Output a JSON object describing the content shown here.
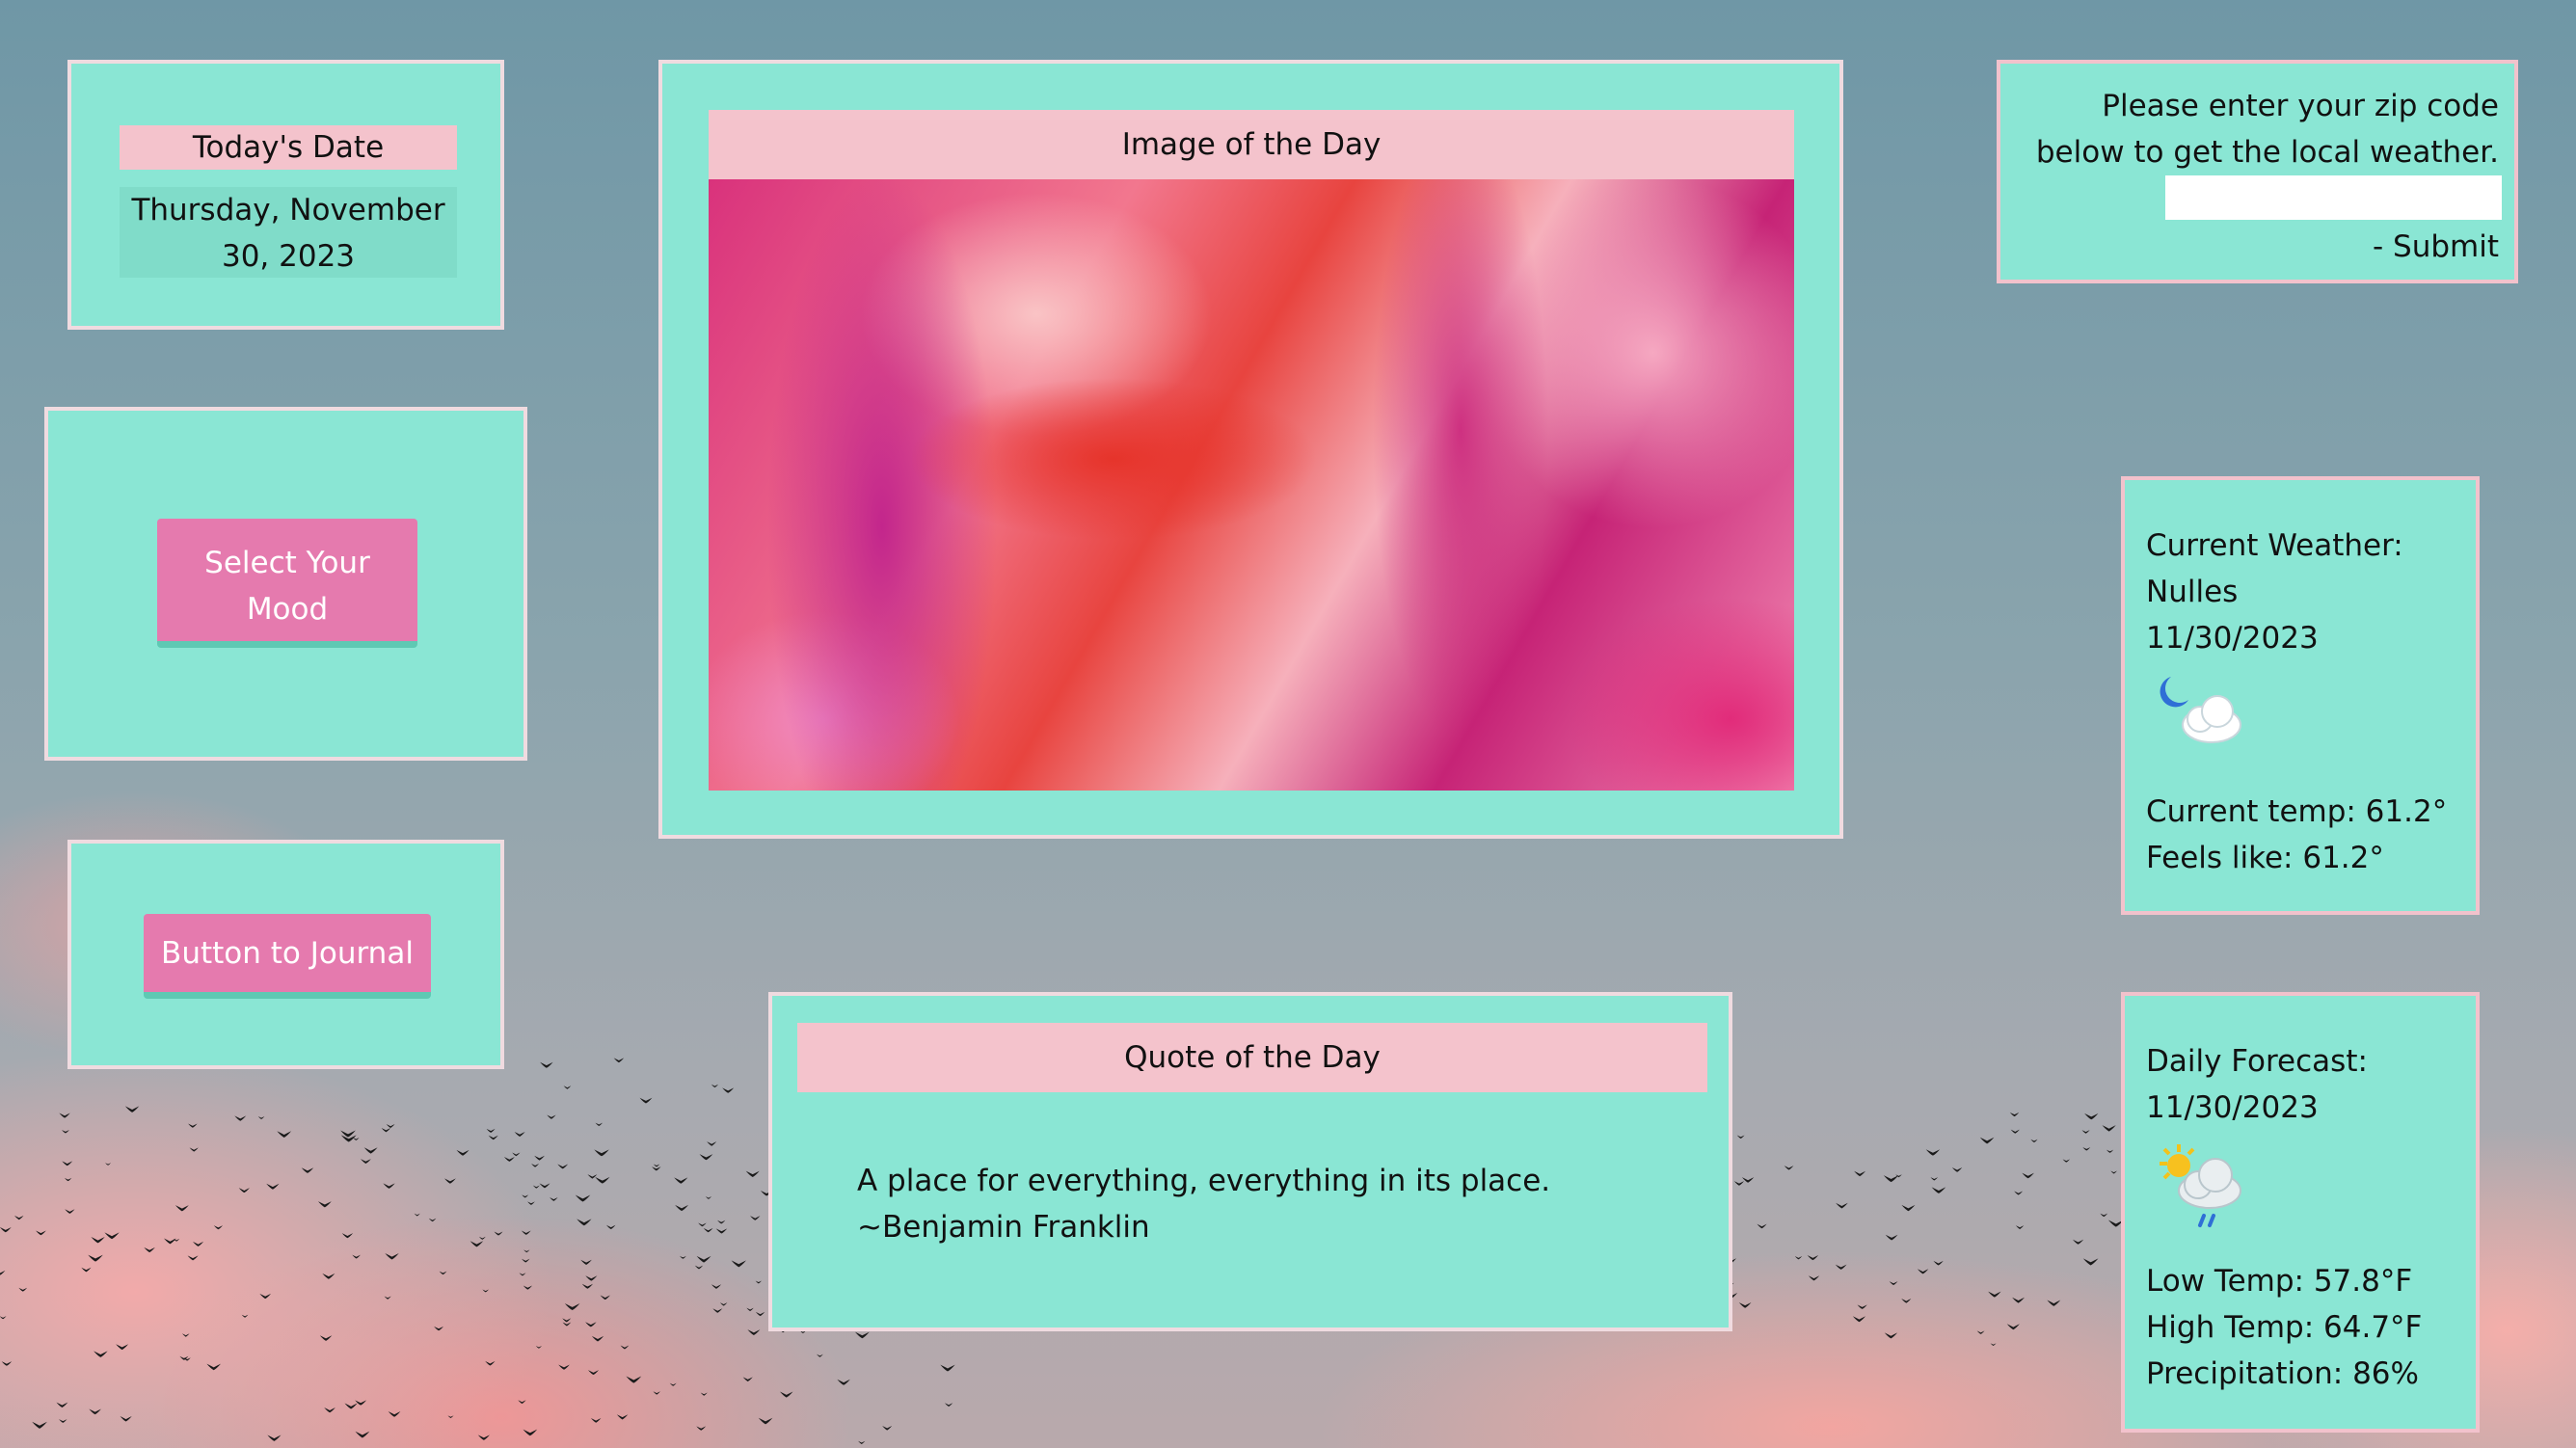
{
  "date_card": {
    "title": "Today's Date",
    "date": "Thursday, November 30, 2023"
  },
  "mood": {
    "button_label": "Select Your Mood"
  },
  "journal": {
    "button_label": "Button to Journal"
  },
  "image_card": {
    "title": "Image of the Day"
  },
  "quote_card": {
    "title": "Quote of the Day",
    "text": "A place for everything, everything in its place. ~Benjamin Franklin"
  },
  "zip": {
    "prompt": "Please enter your zip code below to get the local weather.",
    "input_value": "",
    "submit_label": "- Submit"
  },
  "current_weather": {
    "heading": "Current Weather:",
    "city": "Nulles",
    "date": "11/30/2023",
    "icon": "night-cloudy-icon",
    "temp": "Current temp: 61.2°",
    "feels_like": "Feels like: 61.2°"
  },
  "daily_forecast": {
    "heading": "Daily Forecast:",
    "date": "11/30/2023",
    "icon": "partly-sunny-rain-icon",
    "low": "Low Temp: 57.8°F",
    "high": "High Temp: 64.7°F",
    "precip": "Precipitation: 86%"
  },
  "colors": {
    "panel": "#8ae6d4",
    "header_pink": "#f4c3cc",
    "button_pink": "#e57aae",
    "button_shadow": "#5ec9b3"
  }
}
